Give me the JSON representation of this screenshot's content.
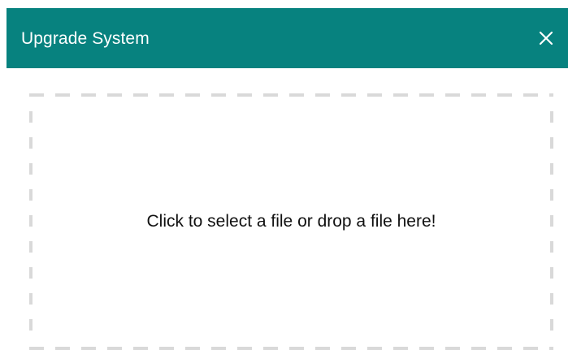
{
  "dialog": {
    "title": "Upgrade System",
    "close_icon": "close-icon",
    "accent_color": "#07827f"
  },
  "dropzone": {
    "prompt": "Click to select a file or drop a file here!",
    "border_color": "#d9d9d9"
  }
}
